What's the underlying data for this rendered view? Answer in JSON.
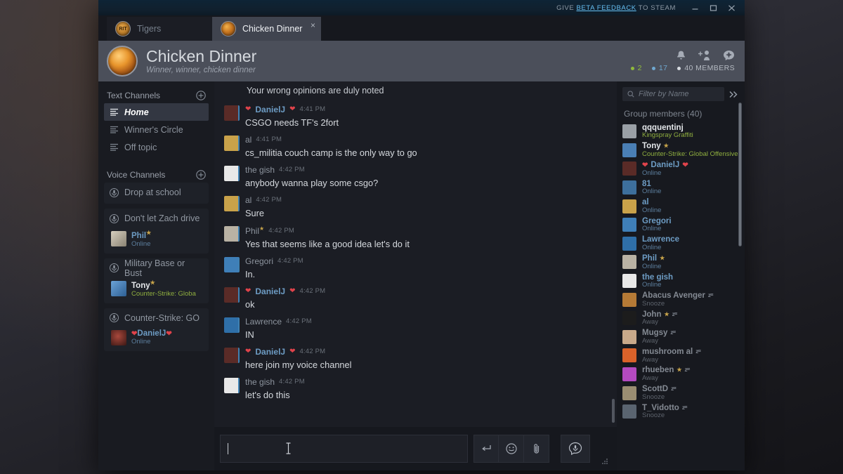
{
  "titlebar": {
    "beta_prefix": "GIVE ",
    "beta_link": "BETA FEEDBACK",
    "beta_suffix": " TO STEAM",
    "minimize": "minimize-button",
    "maximize": "maximize-button",
    "close": "close-button"
  },
  "tabs": [
    {
      "label": "Tigers",
      "active": false,
      "avatar_text": "RIT"
    },
    {
      "label": "Chicken Dinner",
      "active": true,
      "close": "×"
    }
  ],
  "group_header": {
    "title": "Chicken Dinner",
    "subtitle": "Winner, winner, chicken dinner",
    "icons": [
      "bell-icon",
      "add-member-icon",
      "group-settings-icon"
    ],
    "stats": {
      "in_game": "2",
      "online": "17",
      "members": "40 MEMBERS"
    }
  },
  "sidebar": {
    "text_channels_label": "Text Channels",
    "voice_channels_label": "Voice Channels",
    "text_channels": [
      {
        "name": "Home",
        "active": true
      },
      {
        "name": "Winner's Circle",
        "active": false
      },
      {
        "name": "Off topic",
        "active": false
      }
    ],
    "voice_channels": [
      {
        "name": "Drop at school",
        "users": []
      },
      {
        "name": "Don't let Zach drive",
        "users": [
          {
            "name": "Phil",
            "star": true,
            "status": "Online",
            "ingame": false,
            "avatar": "#b9b2a4"
          }
        ]
      },
      {
        "name": "Military Base or Bust",
        "users": [
          {
            "name": "Tony",
            "star": true,
            "status": "Counter-Strike: Globa",
            "ingame": true,
            "avatar": "#4a7fb5"
          }
        ]
      },
      {
        "name": "Counter-Strike: GO",
        "users": [
          {
            "name": "DanielJ",
            "star": false,
            "status": "Online",
            "ingame": false,
            "hearts": true,
            "avatar": "#5a2b27"
          }
        ]
      }
    ]
  },
  "chat": {
    "partial_message": "Your wrong opinions are duly noted",
    "messages": [
      {
        "author": "DanielJ",
        "hearts": true,
        "highlight": true,
        "time": "4:41 PM",
        "text": "CSGO needs TF's 2fort",
        "avatar": "#5a2b27"
      },
      {
        "author": "al",
        "hearts": false,
        "highlight": false,
        "time": "4:41 PM",
        "text": "cs_militia couch camp is the only way to go",
        "avatar": "#c9a24a"
      },
      {
        "author": "the gish",
        "hearts": false,
        "highlight": false,
        "time": "4:42 PM",
        "text": "anybody wanna play some csgo?",
        "avatar": "#e8e8e8"
      },
      {
        "author": "al",
        "hearts": false,
        "highlight": false,
        "time": "4:42 PM",
        "text": "Sure",
        "avatar": "#c9a24a"
      },
      {
        "author": "Phil",
        "star": true,
        "hearts": false,
        "highlight": false,
        "time": "4:42 PM",
        "text": "Yes that seems like a good idea let's do it",
        "avatar": "#b9b2a4"
      },
      {
        "author": "Gregori",
        "hearts": false,
        "highlight": false,
        "time": "4:42 PM",
        "text": "In.",
        "avatar": "#3f7fb8"
      },
      {
        "author": "DanielJ",
        "hearts": true,
        "highlight": true,
        "time": "4:42 PM",
        "text": "ok",
        "avatar": "#5a2b27"
      },
      {
        "author": "Lawrence",
        "hearts": false,
        "highlight": false,
        "time": "4:42 PM",
        "text": "IN",
        "avatar": "#2f6fa8"
      },
      {
        "author": "DanielJ",
        "hearts": true,
        "highlight": true,
        "time": "4:42 PM",
        "text": "here join my voice channel",
        "avatar": "#5a2b27"
      },
      {
        "author": "the gish",
        "hearts": false,
        "highlight": false,
        "time": "4:42 PM",
        "text": "let's do this",
        "avatar": "#e8e8e8"
      }
    ]
  },
  "composer": {
    "value": "",
    "placeholder": "",
    "buttons": [
      "send-enter-icon",
      "emoji-icon",
      "attachment-icon"
    ],
    "voice_button": "voice-chat-icon"
  },
  "members_panel": {
    "filter_placeholder": "Filter by Name",
    "collapse_icon": "chevron-double-right-icon",
    "title": "Group members",
    "count": "(40)",
    "members": [
      {
        "name": "qqquentinj",
        "star": false,
        "sub": "Kingspray Graffiti",
        "state": "ingame",
        "avatar": "#9aa0a6"
      },
      {
        "name": "Tony",
        "star": true,
        "sub": "Counter-Strike: Global Offensive",
        "state": "ingame",
        "avatar": "#4a7fb5"
      },
      {
        "name": "DanielJ",
        "star": false,
        "hearts": true,
        "sub": "Online",
        "state": "online",
        "avatar": "#5a2b27"
      },
      {
        "name": "81",
        "star": false,
        "sub": "Online",
        "state": "online",
        "avatar": "#3d6f9c"
      },
      {
        "name": "al",
        "star": false,
        "sub": "Online",
        "state": "online",
        "avatar": "#c9a24a"
      },
      {
        "name": "Gregori",
        "star": false,
        "sub": "Online",
        "state": "online",
        "avatar": "#3f7fb8"
      },
      {
        "name": "Lawrence",
        "star": false,
        "sub": "Online",
        "state": "online",
        "avatar": "#2f6fa8"
      },
      {
        "name": "Phil",
        "star": true,
        "sub": "Online",
        "state": "online",
        "avatar": "#b9b2a4"
      },
      {
        "name": "the gish",
        "star": false,
        "sub": "Online",
        "state": "online",
        "avatar": "#e8e8e8"
      },
      {
        "name": "Abacus Avenger",
        "star": false,
        "sub": "Snooze",
        "state": "snooze",
        "zzz": true,
        "avatar": "#b57a36"
      },
      {
        "name": "John",
        "star": true,
        "sub": "Away",
        "state": "away",
        "zzz": true,
        "avatar": "#1c1c1c"
      },
      {
        "name": "Mugsy",
        "star": false,
        "sub": "Away",
        "state": "away",
        "zzz": true,
        "avatar": "#c8a98a"
      },
      {
        "name": "mushroom al",
        "star": false,
        "sub": "Away",
        "state": "away",
        "zzz": true,
        "avatar": "#d9622a"
      },
      {
        "name": "rhueben",
        "star": true,
        "sub": "Away",
        "state": "away",
        "zzz": true,
        "avatar": "#b44ac0"
      },
      {
        "name": "ScottD",
        "star": false,
        "sub": "Snooze",
        "state": "snooze",
        "zzz": true,
        "avatar": "#9a8d72"
      },
      {
        "name": "T_Vidotto",
        "star": false,
        "sub": "Snooze",
        "state": "snooze",
        "zzz": true,
        "avatar": "#5a6470"
      }
    ]
  },
  "colors": {
    "accent_blue": "#6d9cc4",
    "link_blue": "#66c0f4",
    "ingame_green": "#90ba3c",
    "heart_red": "#e0434b",
    "window_bg": "#1b1d24",
    "header_bg": "#4b4f5a"
  }
}
